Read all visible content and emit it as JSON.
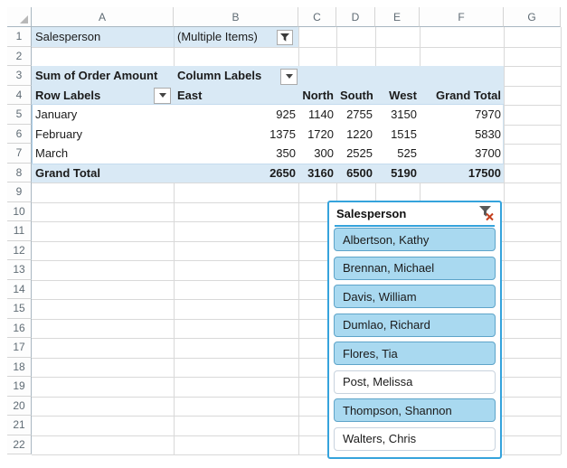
{
  "grid": {
    "column_letters": [
      "A",
      "B",
      "C",
      "D",
      "E",
      "F",
      "G"
    ],
    "row_numbers": [
      "1",
      "2",
      "3",
      "4",
      "5",
      "6",
      "7",
      "8",
      "9",
      "10",
      "11",
      "12",
      "13",
      "14",
      "15",
      "16",
      "17",
      "18",
      "19",
      "20",
      "21",
      "22"
    ]
  },
  "pivot": {
    "filter_field": {
      "label": "Salesperson",
      "value": "(Multiple Items)"
    },
    "measure_label": "Sum of Order Amount",
    "column_labels_label": "Column Labels",
    "row_labels_label": "Row Labels",
    "column_headers": [
      "East",
      "North",
      "South",
      "West",
      "Grand Total"
    ],
    "rows": [
      {
        "label": "January",
        "values": [
          "925",
          "1140",
          "2755",
          "3150",
          "7970"
        ]
      },
      {
        "label": "February",
        "values": [
          "1375",
          "1720",
          "1220",
          "1515",
          "5830"
        ]
      },
      {
        "label": "March",
        "values": [
          "350",
          "300",
          "2525",
          "525",
          "3700"
        ]
      }
    ],
    "grand_total": {
      "label": "Grand Total",
      "values": [
        "2650",
        "3160",
        "6500",
        "5190",
        "17500"
      ]
    }
  },
  "slicer": {
    "title": "Salesperson",
    "items": [
      {
        "label": "Albertson, Kathy",
        "selected": true
      },
      {
        "label": "Brennan, Michael",
        "selected": true
      },
      {
        "label": "Davis, William",
        "selected": true
      },
      {
        "label": "Dumlao, Richard",
        "selected": true
      },
      {
        "label": "Flores, Tia",
        "selected": true
      },
      {
        "label": "Post, Melissa",
        "selected": false
      },
      {
        "label": "Thompson, Shannon",
        "selected": true
      },
      {
        "label": "Walters, Chris",
        "selected": false
      }
    ]
  },
  "colors": {
    "pivot_fill": "#d9e9f5",
    "pivot_border": "#a9cce8",
    "gridline": "#d9d9d9",
    "slicer_border": "#35a3dc",
    "slicer_selected_fill": "#a9d9f0",
    "slicer_selected_border": "#5ea4c9",
    "clear_filter_x": "#c43e1c"
  }
}
